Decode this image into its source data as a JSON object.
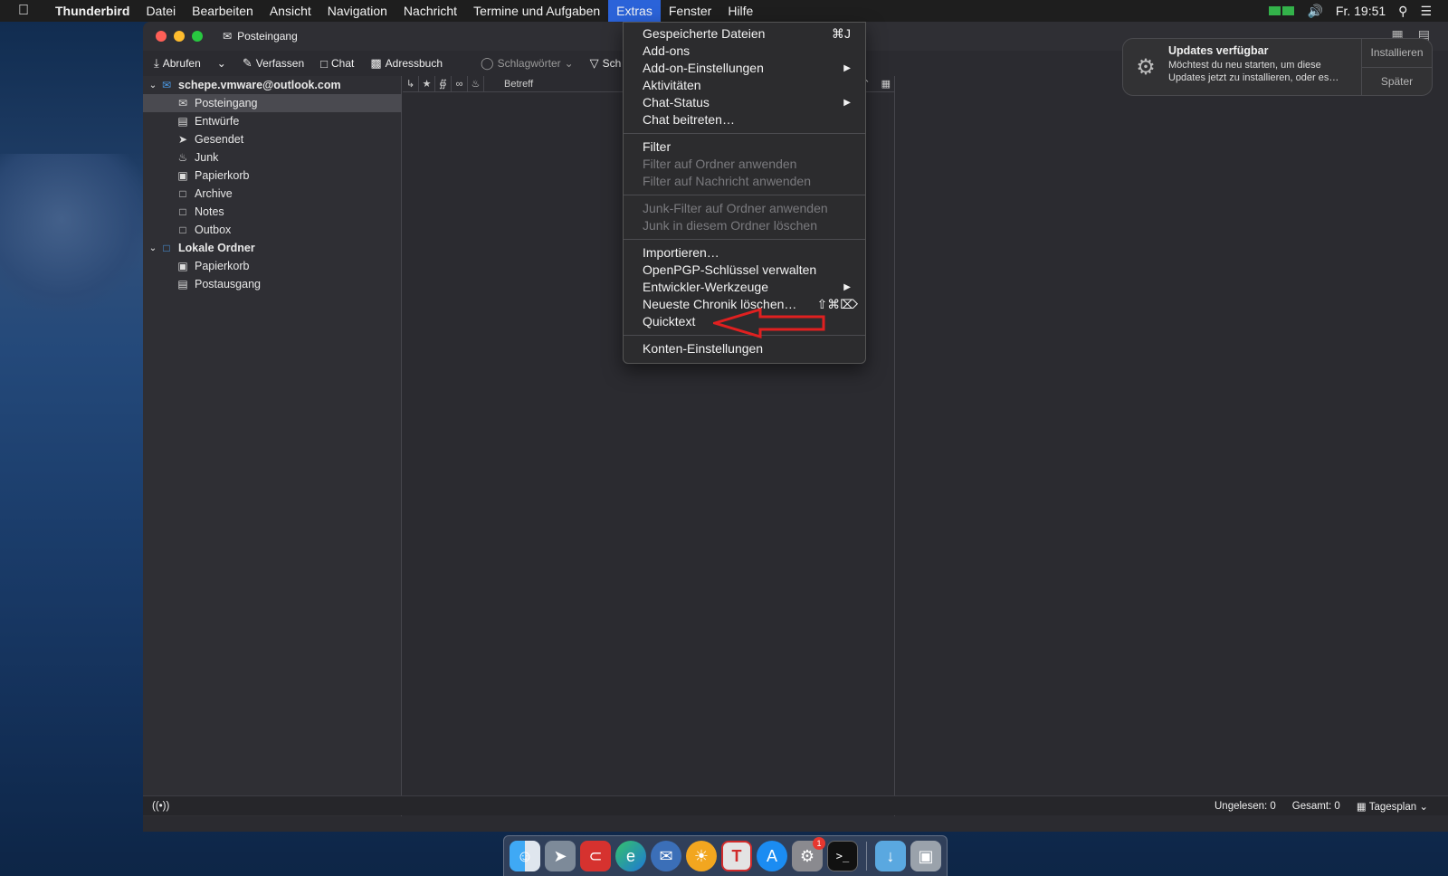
{
  "menubar": {
    "app_name": "Thunderbird",
    "items": [
      "Datei",
      "Bearbeiten",
      "Ansicht",
      "Navigation",
      "Nachricht",
      "Termine und Aufgaben",
      "Extras",
      "Fenster",
      "Hilfe"
    ],
    "active_item": "Extras",
    "clock": "Fr. 19:51"
  },
  "window": {
    "tab_title": "Posteingang",
    "toolbar": {
      "get_messages": "Abrufen",
      "compose": "Verfassen",
      "chat": "Chat",
      "address_book": "Adressbuch",
      "tags": "Schlagwörter",
      "filter_partial": "Sch"
    }
  },
  "folders": {
    "account": "schepe.vmware@outlook.com",
    "account_folders": [
      {
        "label": "Posteingang",
        "icon": "inbox-icon",
        "selected": true
      },
      {
        "label": "Entwürfe",
        "icon": "drafts-icon"
      },
      {
        "label": "Gesendet",
        "icon": "sent-icon"
      },
      {
        "label": "Junk",
        "icon": "junk-icon"
      },
      {
        "label": "Papierkorb",
        "icon": "trash-icon"
      },
      {
        "label": "Archive",
        "icon": "folder-icon"
      },
      {
        "label": "Notes",
        "icon": "folder-icon"
      },
      {
        "label": "Outbox",
        "icon": "folder-icon"
      }
    ],
    "local_account": "Lokale Ordner",
    "local_folders": [
      {
        "label": "Papierkorb",
        "icon": "trash-icon"
      },
      {
        "label": "Postausgang",
        "icon": "outbox-icon"
      }
    ]
  },
  "thread_pane": {
    "subject_header": "Betreff"
  },
  "statusbar": {
    "unread": "Ungelesen: 0",
    "total": "Gesamt: 0",
    "today_pane": "Tagesplan"
  },
  "extras_menu": {
    "groups": [
      [
        {
          "label": "Gespeicherte Dateien",
          "shortcut": "⌘J"
        },
        {
          "label": "Add-ons"
        },
        {
          "label": "Add-on-Einstellungen",
          "submenu": true
        },
        {
          "label": "Aktivitäten"
        },
        {
          "label": "Chat-Status",
          "submenu": true
        },
        {
          "label": "Chat beitreten…"
        }
      ],
      [
        {
          "label": "Filter"
        },
        {
          "label": "Filter auf Ordner anwenden",
          "disabled": true
        },
        {
          "label": "Filter auf Nachricht anwenden",
          "disabled": true
        }
      ],
      [
        {
          "label": "Junk-Filter auf Ordner anwenden",
          "disabled": true
        },
        {
          "label": "Junk in diesem Ordner löschen",
          "disabled": true
        }
      ],
      [
        {
          "label": "Importieren…"
        },
        {
          "label": "OpenPGP-Schlüssel verwalten"
        },
        {
          "label": "Entwickler-Werkzeuge",
          "submenu": true
        },
        {
          "label": "Neueste Chronik löschen…",
          "shortcut": "⇧⌘⌦"
        },
        {
          "label": "Quicktext"
        }
      ],
      [
        {
          "label": "Konten-Einstellungen"
        }
      ]
    ]
  },
  "notification": {
    "title": "Updates verfügbar",
    "text": "Möchtest du neu starten, um diese Updates jetzt zu installieren, oder es…",
    "install_button": "Installieren",
    "later_button": "Später"
  },
  "dock": {
    "apps": [
      "finder-icon",
      "launchpad-icon",
      "dc-icon",
      "edge-icon",
      "thunderbird-icon",
      "xnview-icon",
      "texteditor-icon",
      "appstore-icon",
      "systemprefs-icon",
      "terminal-icon"
    ],
    "system_prefs_badge": "1"
  },
  "annotation_color": "#e02020"
}
